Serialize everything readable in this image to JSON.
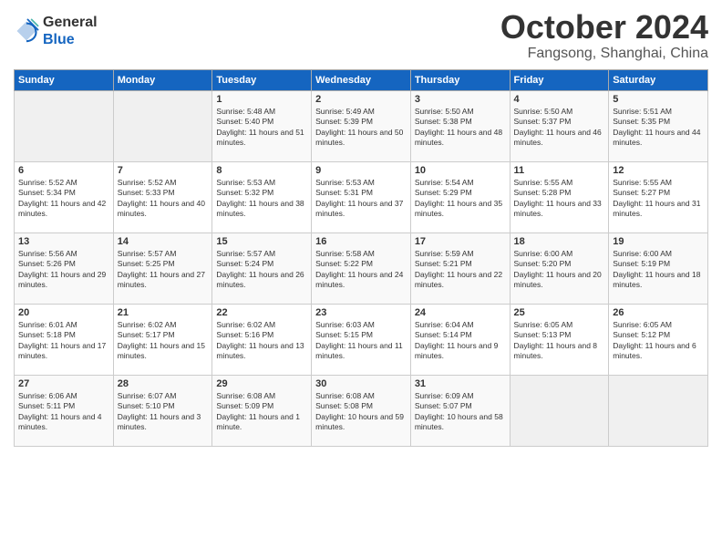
{
  "header": {
    "logo_line1": "General",
    "logo_line2": "Blue",
    "month": "October 2024",
    "location": "Fangsong, Shanghai, China"
  },
  "weekdays": [
    "Sunday",
    "Monday",
    "Tuesday",
    "Wednesday",
    "Thursday",
    "Friday",
    "Saturday"
  ],
  "weeks": [
    [
      {
        "day": "",
        "detail": ""
      },
      {
        "day": "",
        "detail": ""
      },
      {
        "day": "1",
        "detail": "Sunrise: 5:48 AM\nSunset: 5:40 PM\nDaylight: 11 hours and 51 minutes."
      },
      {
        "day": "2",
        "detail": "Sunrise: 5:49 AM\nSunset: 5:39 PM\nDaylight: 11 hours and 50 minutes."
      },
      {
        "day": "3",
        "detail": "Sunrise: 5:50 AM\nSunset: 5:38 PM\nDaylight: 11 hours and 48 minutes."
      },
      {
        "day": "4",
        "detail": "Sunrise: 5:50 AM\nSunset: 5:37 PM\nDaylight: 11 hours and 46 minutes."
      },
      {
        "day": "5",
        "detail": "Sunrise: 5:51 AM\nSunset: 5:35 PM\nDaylight: 11 hours and 44 minutes."
      }
    ],
    [
      {
        "day": "6",
        "detail": "Sunrise: 5:52 AM\nSunset: 5:34 PM\nDaylight: 11 hours and 42 minutes."
      },
      {
        "day": "7",
        "detail": "Sunrise: 5:52 AM\nSunset: 5:33 PM\nDaylight: 11 hours and 40 minutes."
      },
      {
        "day": "8",
        "detail": "Sunrise: 5:53 AM\nSunset: 5:32 PM\nDaylight: 11 hours and 38 minutes."
      },
      {
        "day": "9",
        "detail": "Sunrise: 5:53 AM\nSunset: 5:31 PM\nDaylight: 11 hours and 37 minutes."
      },
      {
        "day": "10",
        "detail": "Sunrise: 5:54 AM\nSunset: 5:29 PM\nDaylight: 11 hours and 35 minutes."
      },
      {
        "day": "11",
        "detail": "Sunrise: 5:55 AM\nSunset: 5:28 PM\nDaylight: 11 hours and 33 minutes."
      },
      {
        "day": "12",
        "detail": "Sunrise: 5:55 AM\nSunset: 5:27 PM\nDaylight: 11 hours and 31 minutes."
      }
    ],
    [
      {
        "day": "13",
        "detail": "Sunrise: 5:56 AM\nSunset: 5:26 PM\nDaylight: 11 hours and 29 minutes."
      },
      {
        "day": "14",
        "detail": "Sunrise: 5:57 AM\nSunset: 5:25 PM\nDaylight: 11 hours and 27 minutes."
      },
      {
        "day": "15",
        "detail": "Sunrise: 5:57 AM\nSunset: 5:24 PM\nDaylight: 11 hours and 26 minutes."
      },
      {
        "day": "16",
        "detail": "Sunrise: 5:58 AM\nSunset: 5:22 PM\nDaylight: 11 hours and 24 minutes."
      },
      {
        "day": "17",
        "detail": "Sunrise: 5:59 AM\nSunset: 5:21 PM\nDaylight: 11 hours and 22 minutes."
      },
      {
        "day": "18",
        "detail": "Sunrise: 6:00 AM\nSunset: 5:20 PM\nDaylight: 11 hours and 20 minutes."
      },
      {
        "day": "19",
        "detail": "Sunrise: 6:00 AM\nSunset: 5:19 PM\nDaylight: 11 hours and 18 minutes."
      }
    ],
    [
      {
        "day": "20",
        "detail": "Sunrise: 6:01 AM\nSunset: 5:18 PM\nDaylight: 11 hours and 17 minutes."
      },
      {
        "day": "21",
        "detail": "Sunrise: 6:02 AM\nSunset: 5:17 PM\nDaylight: 11 hours and 15 minutes."
      },
      {
        "day": "22",
        "detail": "Sunrise: 6:02 AM\nSunset: 5:16 PM\nDaylight: 11 hours and 13 minutes."
      },
      {
        "day": "23",
        "detail": "Sunrise: 6:03 AM\nSunset: 5:15 PM\nDaylight: 11 hours and 11 minutes."
      },
      {
        "day": "24",
        "detail": "Sunrise: 6:04 AM\nSunset: 5:14 PM\nDaylight: 11 hours and 9 minutes."
      },
      {
        "day": "25",
        "detail": "Sunrise: 6:05 AM\nSunset: 5:13 PM\nDaylight: 11 hours and 8 minutes."
      },
      {
        "day": "26",
        "detail": "Sunrise: 6:05 AM\nSunset: 5:12 PM\nDaylight: 11 hours and 6 minutes."
      }
    ],
    [
      {
        "day": "27",
        "detail": "Sunrise: 6:06 AM\nSunset: 5:11 PM\nDaylight: 11 hours and 4 minutes."
      },
      {
        "day": "28",
        "detail": "Sunrise: 6:07 AM\nSunset: 5:10 PM\nDaylight: 11 hours and 3 minutes."
      },
      {
        "day": "29",
        "detail": "Sunrise: 6:08 AM\nSunset: 5:09 PM\nDaylight: 11 hours and 1 minute."
      },
      {
        "day": "30",
        "detail": "Sunrise: 6:08 AM\nSunset: 5:08 PM\nDaylight: 10 hours and 59 minutes."
      },
      {
        "day": "31",
        "detail": "Sunrise: 6:09 AM\nSunset: 5:07 PM\nDaylight: 10 hours and 58 minutes."
      },
      {
        "day": "",
        "detail": ""
      },
      {
        "day": "",
        "detail": ""
      }
    ]
  ]
}
